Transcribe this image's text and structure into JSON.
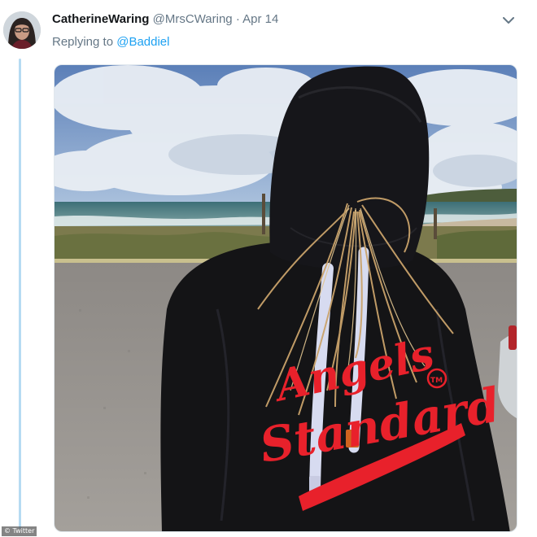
{
  "tweet": {
    "display_name": "CatherineWaring",
    "handle": "@MrsCWaring",
    "separator": "·",
    "date": "Apr 14",
    "reply_prefix": "Replying to",
    "reply_mention": "@Baddiel",
    "avatar_icon": "user-avatar-photo",
    "menu_icon": "chevron-down-icon"
  },
  "photo": {
    "description_icon": "attached-photo",
    "hoodie_brand_line1": "Angels",
    "hoodie_brand_line2": "Standard",
    "hoodie_tm": "TM"
  },
  "watermark": {
    "text": "© Twitter"
  },
  "colors": {
    "link": "#1da1f2",
    "secondary_text": "#657786",
    "thread_line": "#b6dbf2",
    "hoodie": "#141416",
    "print_red": "#e8212b"
  }
}
